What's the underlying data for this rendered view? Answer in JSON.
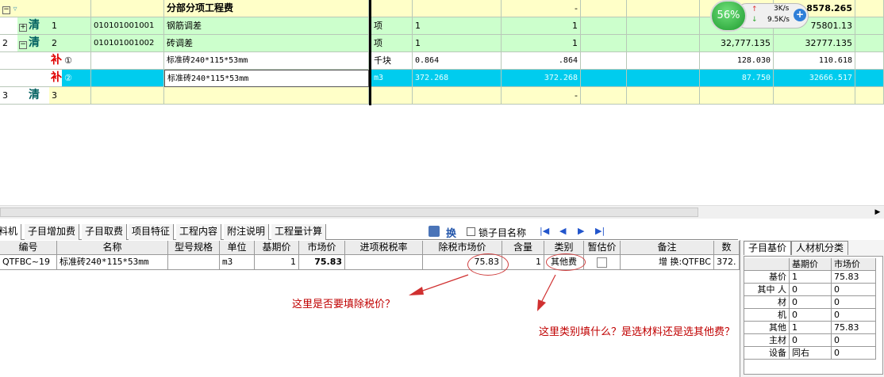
{
  "top_grid": {
    "rows": [
      {
        "index": "",
        "tag": "",
        "code_no": "",
        "code": "",
        "name": "分部分项工程费",
        "unit": "",
        "qty": "",
        "amount": "-",
        "price": "",
        "total": "8578.265"
      },
      {
        "index": "",
        "tag": "清",
        "code_no": "1",
        "code": "010101001001",
        "name": "钢筋调差",
        "unit": "项",
        "qty": "1",
        "amount": "1",
        "price": "",
        "total": "75801.13"
      },
      {
        "index": "2",
        "tag": "清",
        "code_no": "2",
        "code": "010101001002",
        "name": "砖调差",
        "unit": "项",
        "qty": "1",
        "amount": "1",
        "price": "32,777.135",
        "total": "32777.135"
      },
      {
        "index": "",
        "tag": "补",
        "code_no": "①",
        "code": "",
        "name": "标准砖240*115*53mm",
        "unit": "千块",
        "qty": "0.864",
        "amount": ".864",
        "price": "128.030",
        "total": "110.618"
      },
      {
        "index": "",
        "tag": "补",
        "code_no": "②",
        "code": "",
        "name": "标准砖240*115*53mm",
        "unit": "m3",
        "qty": "372.268",
        "amount": "372.268",
        "price": "87.750",
        "total": "32666.517"
      },
      {
        "index": "3",
        "tag": "清",
        "code_no": "3",
        "code": "",
        "name": "",
        "unit": "",
        "qty": "",
        "amount": "-",
        "price": "",
        "total": ""
      }
    ]
  },
  "net_widget": {
    "percent": "56%",
    "upload": "3K/s",
    "download": "9.5K/s"
  },
  "tabs": [
    "料机",
    "子目增加费",
    "子目取费",
    "项目特征",
    "工程内容",
    "附注说明",
    "工程量计算"
  ],
  "toolbar": {
    "swap_label": "换",
    "lock_label": "锁子目名称"
  },
  "bottom_grid": {
    "headers": [
      "编号",
      "名称",
      "型号规格",
      "单位",
      "基期价",
      "市场价",
      "进项税税率",
      "除税市场价",
      "含量",
      "类别",
      "暂估价",
      "备注",
      "数"
    ],
    "row": {
      "code": "QTFBC~19",
      "name": "标准砖240*115*53mm",
      "spec": "",
      "unit": "m3",
      "base_price": "1",
      "market_price": "75.83",
      "tax_rate": "",
      "ex_tax_price": "75.83",
      "content": "1",
      "category": "其他费",
      "provisional": "",
      "remark": "增  换:QTFBC",
      "count": "372."
    }
  },
  "right_panel": {
    "tabs": [
      "子目基价",
      "人材机分类"
    ],
    "headers": [
      "基期价",
      "市场价"
    ],
    "rows": [
      {
        "label": "基价",
        "base": "1",
        "market": "75.83"
      },
      {
        "label": "其中 人",
        "base": "0",
        "market": "0"
      },
      {
        "label": "材",
        "base": "0",
        "market": "0"
      },
      {
        "label": "机",
        "base": "0",
        "market": "0"
      },
      {
        "label": "其他",
        "base": "1",
        "market": "75.83"
      },
      {
        "label": "主材",
        "base": "0",
        "market": "0"
      },
      {
        "label": "设备",
        "base": "同右",
        "market": "0"
      }
    ]
  },
  "annotations": {
    "note1": "这里是否要填除税价？",
    "note2": "这里类别填什么？是选材料还是选其他费？"
  },
  "colors": {
    "highlight": "#00ccee",
    "annotation": "#cc0000",
    "green_row": "#ccffcc",
    "yellow_row": "#ffffc8"
  }
}
